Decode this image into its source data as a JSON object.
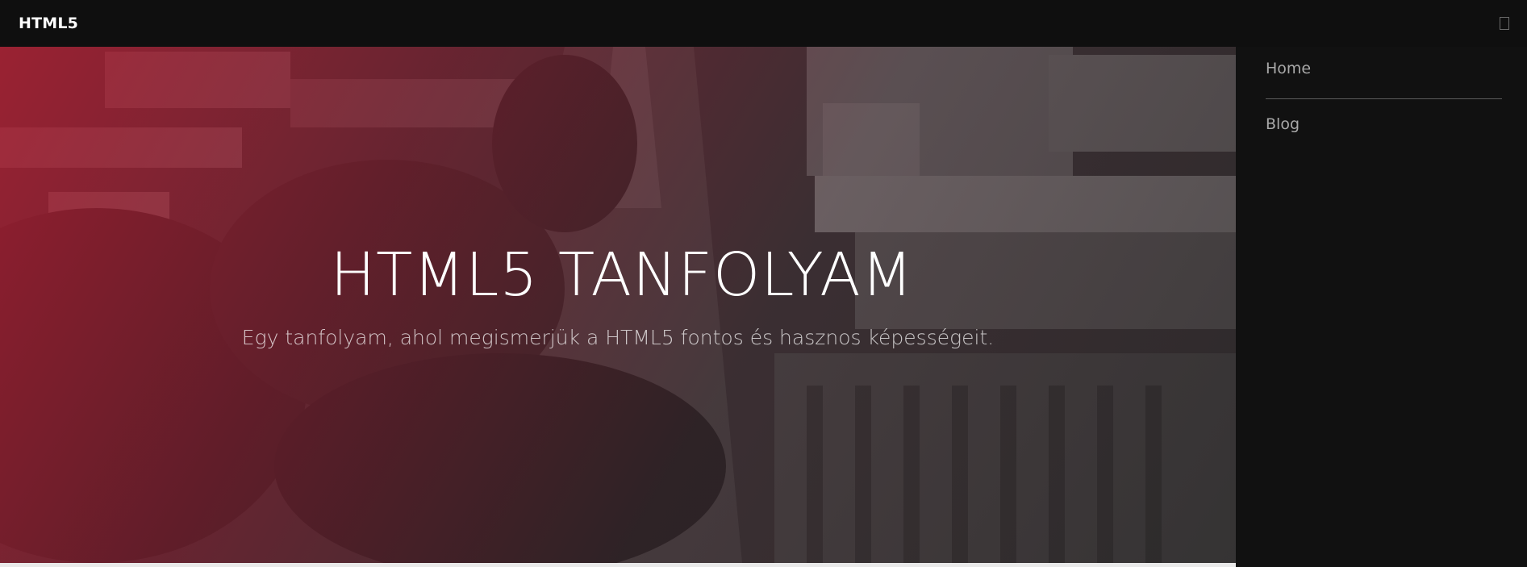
{
  "header": {
    "brand": "HTML5"
  },
  "hero": {
    "title": "HTML5 TANFOLYAM",
    "subtitle": "Egy tanfolyam, ahol megismerjük a HTML5 fontos és hasznos képességeit."
  },
  "sidebar": {
    "items": [
      {
        "label": "Home"
      },
      {
        "label": "Blog"
      }
    ]
  },
  "colors": {
    "header_bg": "#0f0f0f",
    "sidebar_bg": "#111111",
    "accent_red": "#af1e32"
  }
}
